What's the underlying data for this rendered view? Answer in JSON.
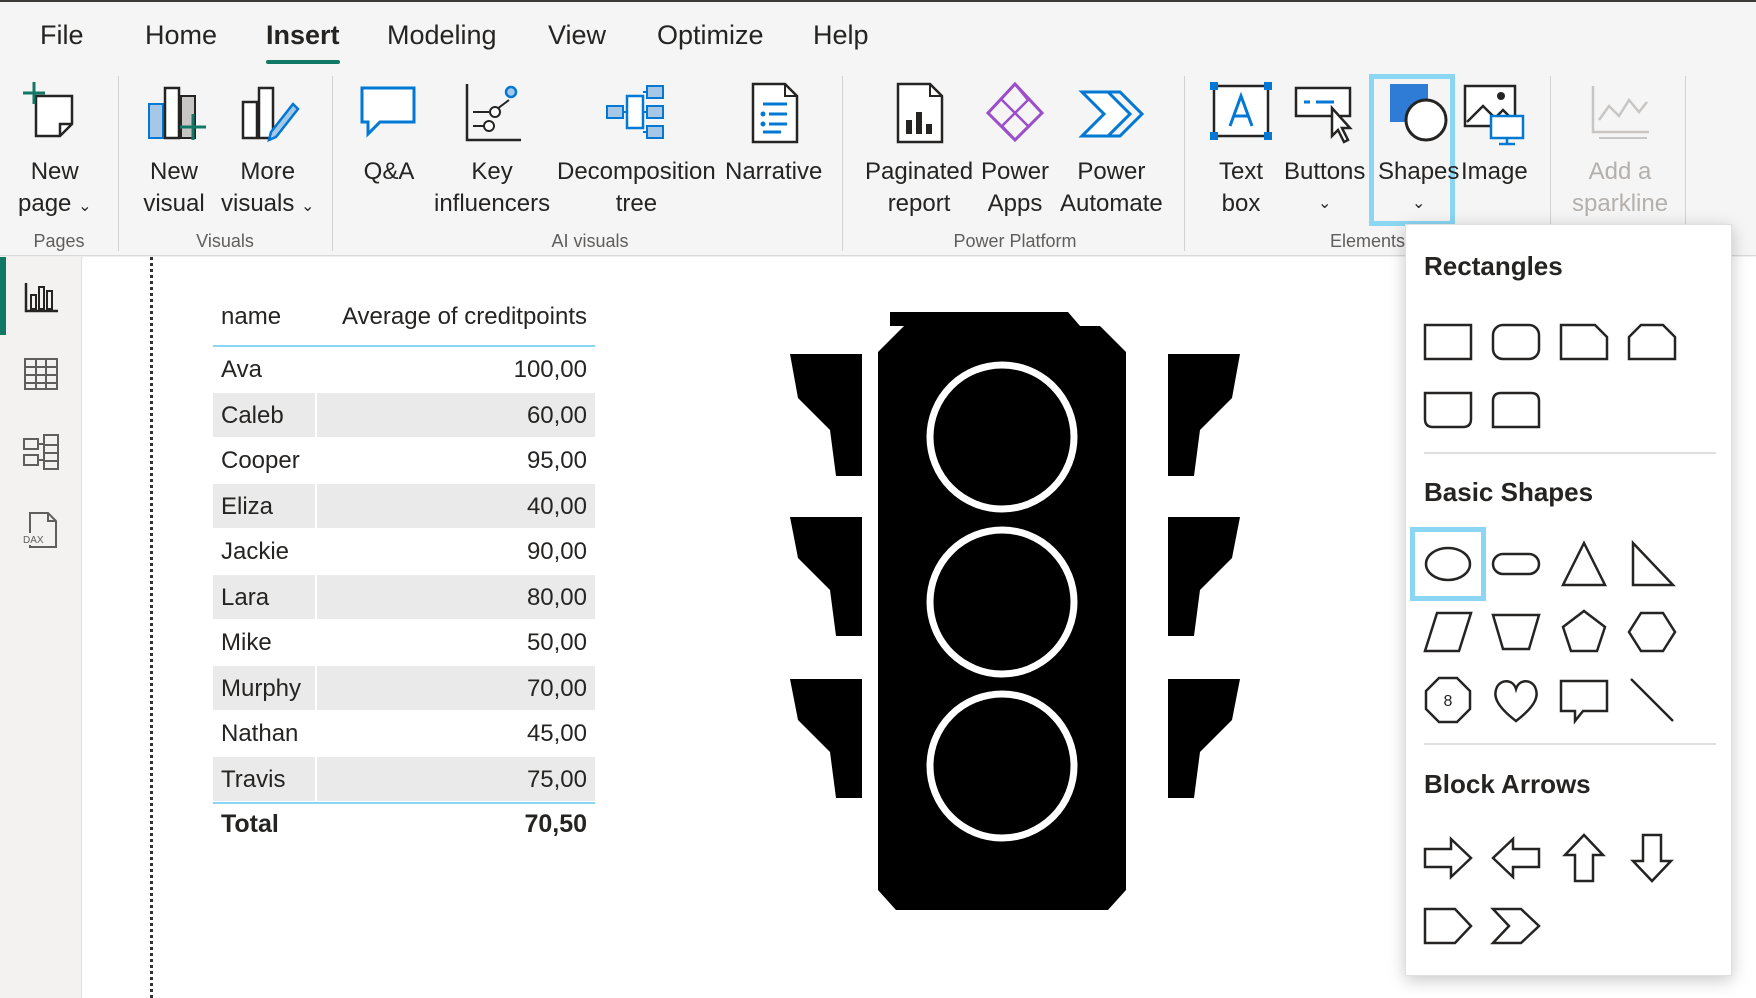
{
  "menu_tabs": [
    "File",
    "Home",
    "Insert",
    "Modeling",
    "View",
    "Optimize",
    "Help"
  ],
  "active_tab": "Insert",
  "ribbon": {
    "buttons": {
      "new_page": [
        "New",
        "page"
      ],
      "new_visual": [
        "New",
        "visual"
      ],
      "more_visuals": [
        "More",
        "visuals"
      ],
      "qa": [
        "Q&A"
      ],
      "key_influencers": [
        "Key",
        "influencers"
      ],
      "decomposition_tree": [
        "Decomposition",
        "tree"
      ],
      "narrative": [
        "Narrative"
      ],
      "paginated_report": [
        "Paginated",
        "report"
      ],
      "power_apps": [
        "Power",
        "Apps"
      ],
      "power_automate": [
        "Power",
        "Automate"
      ],
      "text_box": [
        "Text",
        "box"
      ],
      "buttons": [
        "Buttons"
      ],
      "shapes": [
        "Shapes"
      ],
      "image": [
        "Image"
      ],
      "add_sparkline": [
        "Add a",
        "sparkline"
      ]
    },
    "groups": {
      "pages": "Pages",
      "visuals": "Visuals",
      "ai_visuals": "AI visuals",
      "power_platform": "Power Platform",
      "elements": "Elements"
    },
    "colors": {
      "accent": "#117865",
      "highlight": "#8ad6f3",
      "icon_blue": "#0078d4",
      "icon_purple": "#9b4dca"
    }
  },
  "left_rail": [
    "report-view-icon",
    "table-view-icon",
    "model-view-icon",
    "dax-query-icon"
  ],
  "table": {
    "columns": [
      "name",
      "Average of creditpoints"
    ],
    "rows": [
      [
        "Ava",
        "100,00"
      ],
      [
        "Caleb",
        "60,00"
      ],
      [
        "Cooper",
        "95,00"
      ],
      [
        "Eliza",
        "40,00"
      ],
      [
        "Jackie",
        "90,00"
      ],
      [
        "Lara",
        "80,00"
      ],
      [
        "Mike",
        "50,00"
      ],
      [
        "Murphy",
        "70,00"
      ],
      [
        "Nathan",
        "45,00"
      ],
      [
        "Travis",
        "75,00"
      ]
    ],
    "total": [
      "Total",
      "70,50"
    ]
  },
  "shapes_panel": {
    "sections": {
      "rectangles": "Rectangles",
      "basic_shapes": "Basic Shapes",
      "block_arrows": "Block Arrows"
    },
    "octagon_glyph": "8"
  }
}
